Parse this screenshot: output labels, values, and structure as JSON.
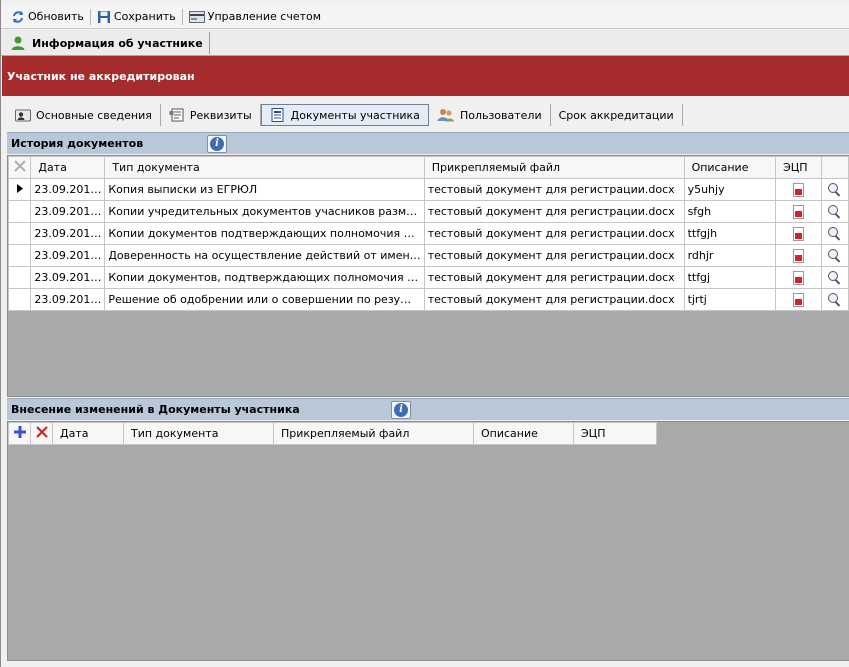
{
  "toolbar": {
    "refresh_label": "Обновить",
    "save_label": "Сохранить",
    "account_label": "Управление счетом"
  },
  "form_tab": {
    "label": "Информация об участнике"
  },
  "banner": {
    "text": "Участник не аккредитирован",
    "color": "#a62b2d"
  },
  "section_tabs": [
    {
      "label": "Основные сведения",
      "icon": "user-card-icon"
    },
    {
      "label": "Реквизиты",
      "icon": "props-icon"
    },
    {
      "label": "Документы участника",
      "icon": "documents-icon",
      "active": true
    },
    {
      "label": "Пользователи",
      "icon": "users-icon"
    },
    {
      "label": "Срок аккредитации",
      "icon": ""
    }
  ],
  "history": {
    "title": "История документов",
    "columns": [
      "Дата",
      "Тип документа",
      "Прикрепляемый файл",
      "Описание",
      "ЭЦП"
    ],
    "rows": [
      {
        "date": "23.09.201…",
        "type": "Копия выписки из ЕГРЮЛ",
        "file": "тестовый документ для регистрации.docx",
        "desc": "y5uhjy"
      },
      {
        "date": "23.09.201…",
        "type": "Копии учредительных документов учасников разм…",
        "file": "тестовый документ для регистрации.docx",
        "desc": "sfgh"
      },
      {
        "date": "23.09.201…",
        "type": "Копии документов подтверждающих полномочия …",
        "file": "тестовый документ для регистрации.docx",
        "desc": "ttfgjh"
      },
      {
        "date": "23.09.201…",
        "type": "Доверенность на осуществление действий от имен…",
        "file": "тестовый документ для регистрации.docx",
        "desc": "rdhjr"
      },
      {
        "date": "23.09.201…",
        "type": "Копии документов, подтверждающих полномочия …",
        "file": "тестовый документ для регистрации.docx",
        "desc": "ttfgj"
      },
      {
        "date": "23.09.201…",
        "type": "Решение об одобрении или о совершении по резу…",
        "file": "тестовый документ для регистрации.docx",
        "desc": "tjrtj"
      }
    ]
  },
  "changes": {
    "title": "Внесение изменений в Документы участника",
    "columns": [
      "Дата",
      "Тип документа",
      "Прикрепляемый файл",
      "Описание",
      "ЭЦП"
    ]
  }
}
